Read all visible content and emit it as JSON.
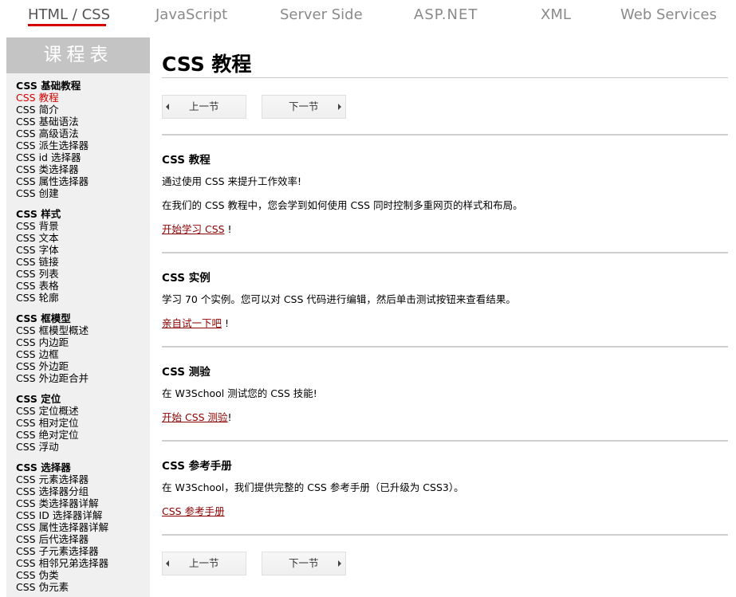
{
  "topnav": {
    "items": [
      "HTML / CSS",
      "JavaScript",
      "Server Side",
      "ASP.NET",
      "XML",
      "Web Services"
    ],
    "accent": "#d40000"
  },
  "sidebar": {
    "title": "课程表",
    "groups": [
      {
        "title": "CSS 基础教程",
        "items": [
          "CSS 教程",
          "CSS 简介",
          "CSS 基础语法",
          "CSS 高级语法",
          "CSS 派生选择器",
          "CSS id 选择器",
          "CSS 类选择器",
          "CSS 属性选择器",
          "CSS 创建"
        ]
      },
      {
        "title": "CSS 样式",
        "items": [
          "CSS 背景",
          "CSS 文本",
          "CSS 字体",
          "CSS 链接",
          "CSS 列表",
          "CSS 表格",
          "CSS 轮廓"
        ]
      },
      {
        "title": "CSS 框模型",
        "items": [
          "CSS 框模型概述",
          "CSS 内边距",
          "CSS 边框",
          "CSS 外边距",
          "CSS 外边距合并"
        ]
      },
      {
        "title": "CSS 定位",
        "items": [
          "CSS 定位概述",
          "CSS 相对定位",
          "CSS 绝对定位",
          "CSS 浮动"
        ]
      },
      {
        "title": "CSS 选择器",
        "items": [
          "CSS 元素选择器",
          "CSS 选择器分组",
          "CSS 类选择器详解",
          "CSS ID 选择器详解",
          "CSS 属性选择器详解",
          "CSS 后代选择器",
          "CSS 子元素选择器",
          "CSS 相邻兄弟选择器",
          "CSS 伪类",
          "CSS 伪元素"
        ]
      }
    ]
  },
  "main": {
    "title": "CSS 教程",
    "pager": {
      "prev": "上一节",
      "next": "下一节"
    },
    "sections": [
      {
        "heading": "CSS 教程",
        "p1": "通过使用 CSS 来提升工作效率!",
        "p2": "在我们的 CSS 教程中，您会学到如何使用 CSS 同时控制多重网页的样式和布局。",
        "link": "开始学习 CSS",
        "suffix": " !"
      },
      {
        "heading": "CSS 实例",
        "p1": "学习 70 个实例。您可以对 CSS 代码进行编辑，然后单击测试按钮来查看结果。",
        "link": "亲自试一下吧",
        "suffix": " !"
      },
      {
        "heading": "CSS 测验",
        "p1": "在 W3School 测试您的 CSS 技能!",
        "link": "开始 CSS 测验",
        "suffix": "!"
      },
      {
        "heading": "CSS 参考手册",
        "p1": "在 W3School，我们提供完整的 CSS 参考手册（已升级为 CSS3）。",
        "link": "CSS 参考手册",
        "suffix": ""
      }
    ]
  }
}
